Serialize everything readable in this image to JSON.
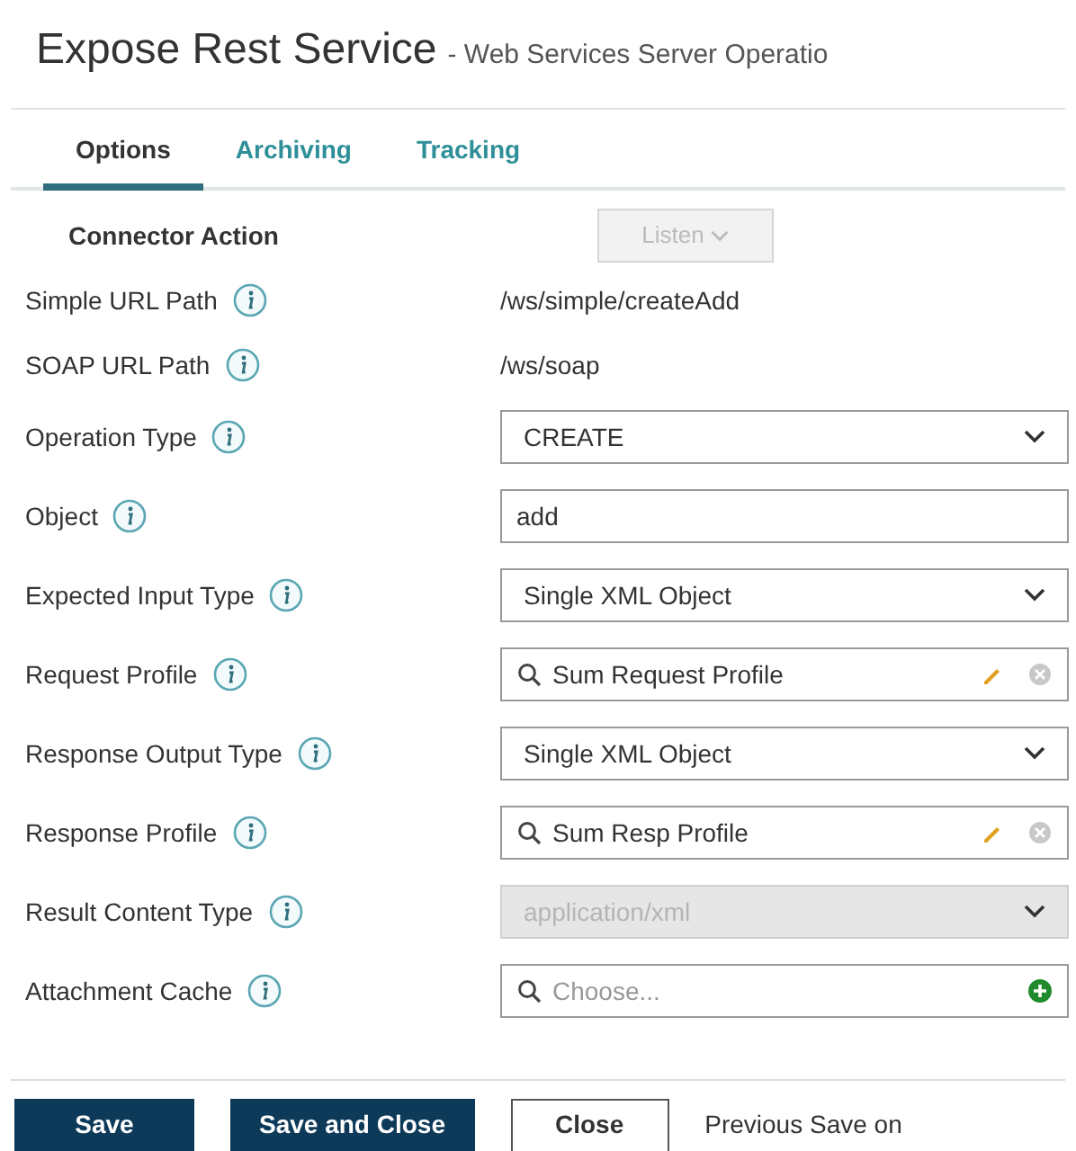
{
  "title": "Expose Rest Service",
  "subtitle": "- Web Services Server Operatio",
  "tabs": [
    {
      "label": "Options",
      "selected": true
    },
    {
      "label": "Archiving",
      "selected": false
    },
    {
      "label": "Tracking",
      "selected": false
    }
  ],
  "connector_action": {
    "label": "Connector Action",
    "value": "Listen",
    "disabled": true
  },
  "fields": [
    {
      "label": "Simple URL Path",
      "kind": "text",
      "value": "/ws/simple/createAdd"
    },
    {
      "label": "SOAP URL Path",
      "kind": "text",
      "value": "/ws/soap"
    },
    {
      "label": "Operation Type",
      "kind": "select",
      "value": "CREATE",
      "disabled": false
    },
    {
      "label": "Object",
      "kind": "input",
      "value": "add"
    },
    {
      "label": "Expected Input Type",
      "kind": "select",
      "value": "Single XML Object",
      "disabled": false
    },
    {
      "label": "Request Profile",
      "kind": "lookup",
      "value": "Sum Request Profile"
    },
    {
      "label": "Response Output Type",
      "kind": "select",
      "value": "Single XML Object",
      "disabled": false
    },
    {
      "label": "Response Profile",
      "kind": "lookup",
      "value": "Sum Resp Profile"
    },
    {
      "label": "Result Content Type",
      "kind": "select",
      "value": "application/xml",
      "disabled": true
    },
    {
      "label": "Attachment Cache",
      "kind": "lookup-add",
      "placeholder": "Choose..."
    }
  ],
  "buttons": [
    {
      "label": "Save",
      "kind": "primary"
    },
    {
      "label": "Save and Close",
      "kind": "primary"
    },
    {
      "label": "Close",
      "kind": "secondary"
    }
  ],
  "status": "Previous Save on"
}
